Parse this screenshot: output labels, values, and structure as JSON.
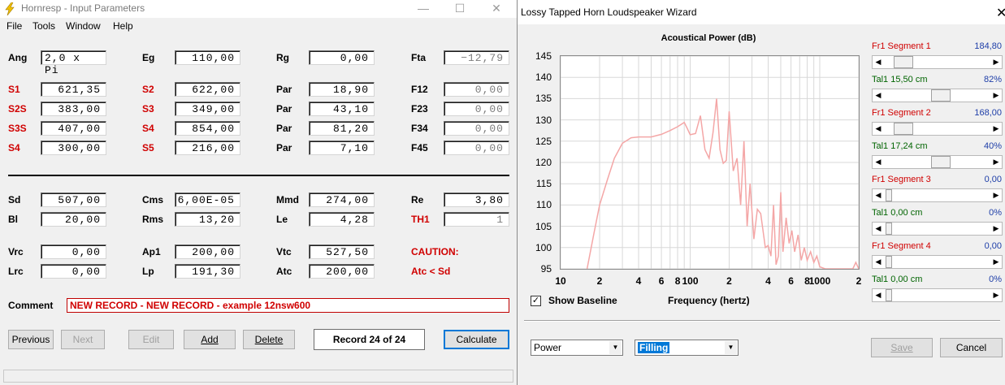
{
  "hornresp": {
    "title": "Hornresp - Input Parameters",
    "menu": [
      "File",
      "Tools",
      "Window",
      "Help"
    ],
    "rows_top": [
      {
        "l1": "Ang",
        "v1": "2,0 x Pi",
        "l2": "Eg",
        "v2": "110,00",
        "l3": "Rg",
        "v3": "0,00",
        "l4": "Fta",
        "v4": "−12,79"
      },
      {
        "l1": "S1",
        "v1": "621,35",
        "l2": "S2",
        "v2": "622,00",
        "l3": "Par",
        "v3": "18,90",
        "l4": "F12",
        "v4": "0,00"
      },
      {
        "l1": "S2S",
        "v1": "383,00",
        "l2": "S3",
        "v2": "349,00",
        "l3": "Par",
        "v3": "43,10",
        "l4": "F23",
        "v4": "0,00"
      },
      {
        "l1": "S3S",
        "v1": "407,00",
        "l2": "S4",
        "v2": "854,00",
        "l3": "Par",
        "v3": "81,20",
        "l4": "F34",
        "v4": "0,00"
      },
      {
        "l1": "S4",
        "v1": "300,00",
        "l2": "S5",
        "v2": "216,00",
        "l3": "Par",
        "v3": "7,10",
        "l4": "F45",
        "v4": "0,00"
      }
    ],
    "rows_bottom": [
      {
        "l1": "Sd",
        "v1": "507,00",
        "l2": "Cms",
        "v2": "6,00E-05",
        "l3": "Mmd",
        "v3": "274,00",
        "l4": "Re",
        "v4": "3,80"
      },
      {
        "l1": "Bl",
        "v1": "20,00",
        "l2": "Rms",
        "v2": "13,20",
        "l3": "Le",
        "v3": "4,28",
        "l4": "TH1",
        "v4": "1"
      },
      {
        "l1": "Vrc",
        "v1": "0,00",
        "l2": "Ap1",
        "v2": "200,00",
        "l3": "Vtc",
        "v3": "527,50",
        "l4": "CAUTION:"
      },
      {
        "l1": "Lrc",
        "v1": "0,00",
        "l2": "Lp",
        "v2": "191,30",
        "l3": "Atc",
        "v3": "200,00",
        "l4": "Atc < Sd"
      }
    ],
    "comment_label": "Comment",
    "comment": "NEW RECORD - NEW RECORD - example 12nsw600",
    "buttons": {
      "previous": "Previous",
      "next": "Next",
      "edit": "Edit",
      "add": "Add",
      "delete": "Delete",
      "calculate": "Calculate"
    },
    "record": "Record 24 of 24"
  },
  "wizard": {
    "title": "Lossy Tapped Horn Loudspeaker Wizard",
    "show_baseline": "Show Baseline",
    "dropdown1": "Power",
    "dropdown2": "Filling",
    "save": "Save",
    "cancel": "Cancel",
    "sliders": [
      {
        "label": "Fr1  Segment 1",
        "value": "184,80",
        "kind": "fr"
      },
      {
        "label": "Tal1  15,50 cm",
        "value": "82%",
        "kind": "tal"
      },
      {
        "label": "Fr1  Segment 2",
        "value": "168,00",
        "kind": "fr"
      },
      {
        "label": "Tal1  17,24 cm",
        "value": "40%",
        "kind": "tal"
      },
      {
        "label": "Fr1  Segment 3",
        "value": "0,00",
        "kind": "fr"
      },
      {
        "label": "Tal1  0,00 cm",
        "value": "0%",
        "kind": "tal"
      },
      {
        "label": "Fr1  Segment 4",
        "value": "0,00",
        "kind": "fr"
      },
      {
        "label": "Tal1  0,00 cm",
        "value": "0%",
        "kind": "tal"
      }
    ],
    "slider_levels": [
      0.1,
      0.54,
      0.1,
      0.54,
      0.0,
      0.0,
      0.0,
      0.0
    ]
  },
  "chart_data": {
    "type": "line",
    "title": "Acoustical Power (dB)",
    "xlabel": "Frequency (hertz)",
    "ylabel": "",
    "x_scale": "log",
    "xlim": [
      10,
      2000
    ],
    "ylim": [
      95,
      145
    ],
    "yticks": [
      145,
      140,
      135,
      130,
      125,
      120,
      115,
      110,
      105,
      100,
      95
    ],
    "xticks": [
      {
        "v": 10,
        "t": "10"
      },
      {
        "v": 20,
        "t": "2"
      },
      {
        "v": 40,
        "t": "4"
      },
      {
        "v": 60,
        "t": "6"
      },
      {
        "v": 80,
        "t": "8"
      },
      {
        "v": 100,
        "t": "100"
      },
      {
        "v": 200,
        "t": "2"
      },
      {
        "v": 400,
        "t": "4"
      },
      {
        "v": 600,
        "t": "6"
      },
      {
        "v": 800,
        "t": "8"
      },
      {
        "v": 1000,
        "t": "1000"
      },
      {
        "v": 2000,
        "t": "2"
      }
    ],
    "grid": true,
    "line_color": "#f4a6a6",
    "series": [
      {
        "x": [
          16,
          18,
          20,
          23,
          26,
          30,
          35,
          40,
          50,
          60,
          70,
          80,
          90,
          95,
          100,
          110,
          120,
          130,
          140,
          150,
          160,
          170,
          180,
          190,
          200,
          215,
          230,
          245,
          260,
          275,
          290,
          310,
          330,
          350,
          380,
          400,
          420,
          440,
          460,
          480,
          500,
          520,
          550,
          580,
          610,
          640,
          680,
          720,
          760,
          800,
          850,
          900,
          950,
          1000,
          1100,
          1200,
          1400,
          1600,
          1800,
          1900,
          2000
        ],
        "y": [
          95,
          103,
          110,
          116,
          121,
          124.5,
          125.8,
          126,
          126,
          126.6,
          127.5,
          128.4,
          129.4,
          128,
          126.5,
          126.8,
          131,
          123,
          121,
          127,
          135,
          123,
          119.8,
          120.5,
          132,
          118,
          121,
          110,
          125,
          105,
          115,
          102,
          109,
          108,
          100,
          100.5,
          98,
          110,
          96,
          98,
          113,
          99,
          107,
          101,
          104,
          99,
          103,
          97,
          100,
          97,
          99,
          96.5,
          98,
          95.5,
          95,
          95,
          95,
          95,
          95,
          96.5,
          95
        ]
      }
    ]
  }
}
